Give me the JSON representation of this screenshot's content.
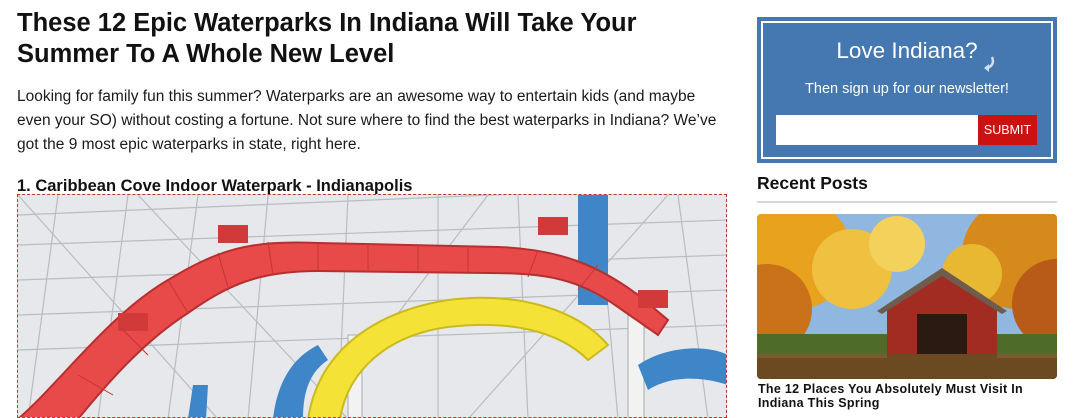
{
  "article": {
    "title": "These 12 Epic Waterparks In Indiana Will Take Your Summer To A Whole New Level",
    "intro": "Looking for family fun this summer? Waterparks are an awesome way to entertain kids (and maybe even your SO) without costing a fortune. Not sure where to find the best waterparks in Indiana? We’ve got the 9 most epic waterparks in state, right here.",
    "sections": [
      {
        "heading": "1. Caribbean Cove Indoor Waterpark - Indianapolis"
      }
    ]
  },
  "sidebar": {
    "newsletter": {
      "title": "Love Indiana?",
      "subtitle": "Then sign up for our newsletter!",
      "email_value": "",
      "submit_label": "SUBMIT",
      "background_color": "#4577b1",
      "button_color": "#cc1111"
    },
    "recent_posts": {
      "heading": "Recent Posts",
      "items": [
        {
          "title": "The 12 Places You Absolutely Must Visit In Indiana This Spring"
        }
      ]
    }
  }
}
